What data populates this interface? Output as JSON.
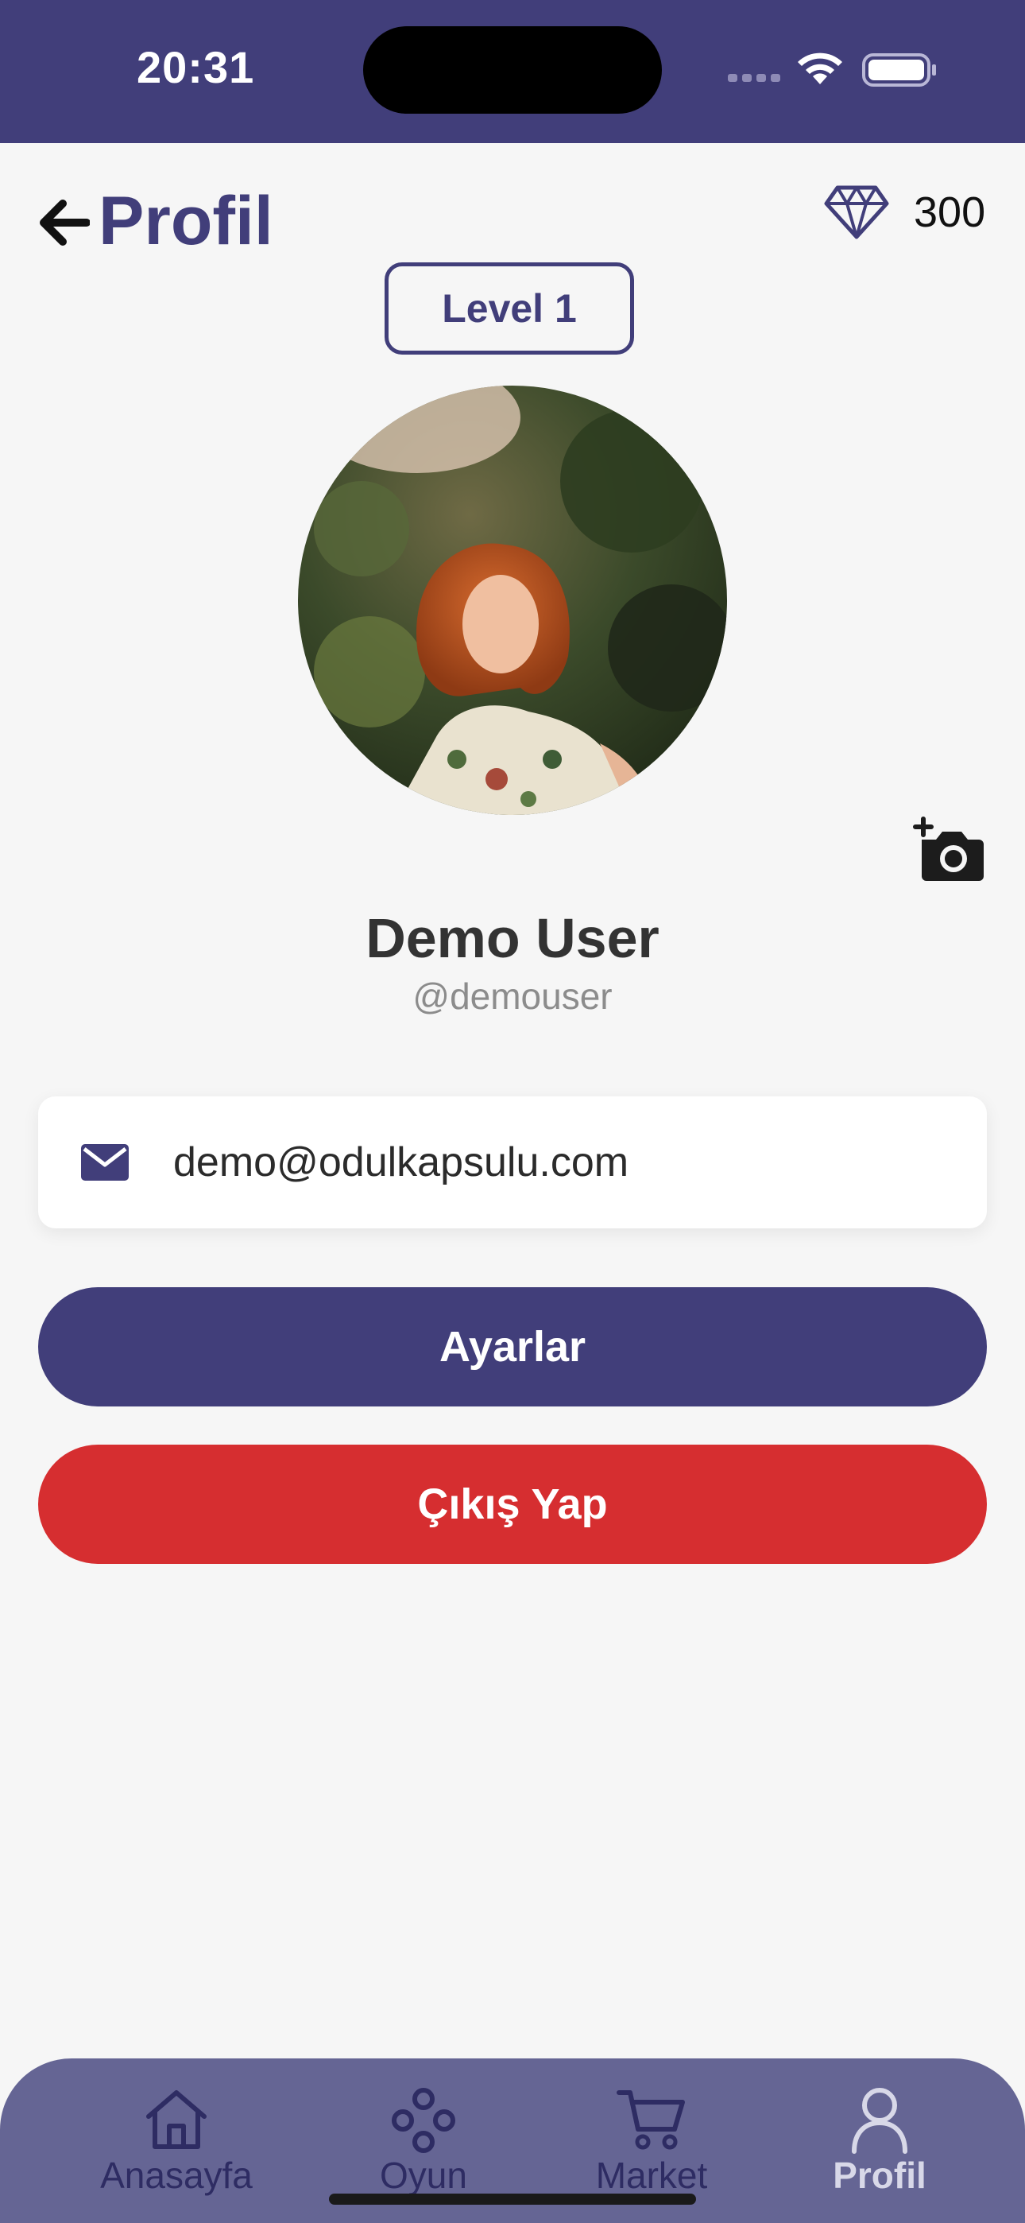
{
  "status": {
    "time": "20:31"
  },
  "header": {
    "title": "Profil",
    "back_icon": "arrow-left-icon"
  },
  "gems": {
    "count": "300",
    "icon": "diamond-icon"
  },
  "level": {
    "label": "Level 1"
  },
  "profile": {
    "name": "Demo User",
    "username": "@demouser",
    "email": "demo@odulkapsulu.com"
  },
  "buttons": {
    "settings": "Ayarlar",
    "logout": "Çıkış Yap"
  },
  "tabs": [
    {
      "label": "Anasayfa",
      "icon": "home-icon"
    },
    {
      "label": "Oyun",
      "icon": "game-icon"
    },
    {
      "label": "Market",
      "icon": "cart-icon"
    },
    {
      "label": "Profil",
      "icon": "user-icon",
      "active": true
    }
  ],
  "colors": {
    "primary": "#413e7a",
    "danger": "#d62e30",
    "tabbar": "#656594",
    "background": "#f6f6f6"
  }
}
